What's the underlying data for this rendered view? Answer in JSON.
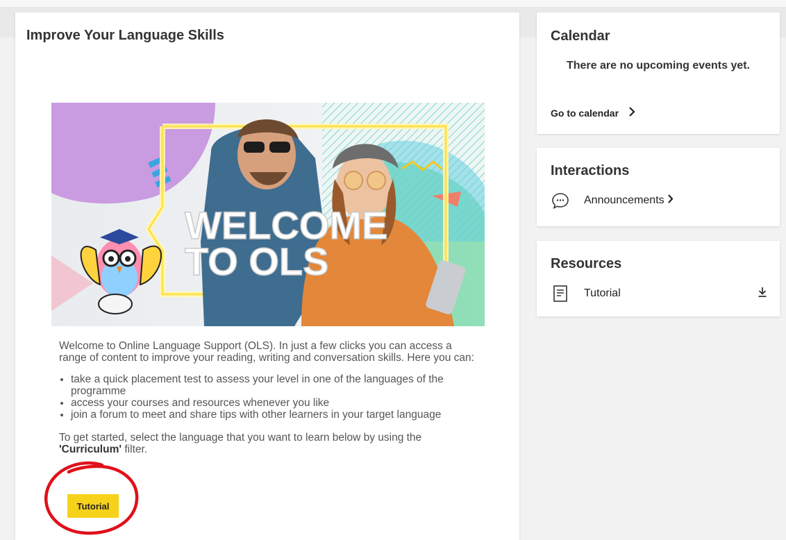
{
  "main": {
    "title": "Improve Your Language Skills",
    "banner": {
      "headline_line1": "WELCOME",
      "headline_line2": "TO OLS"
    },
    "intro": "Welcome to Online Language Support (OLS). In just a few clicks you can access a range of content to improve your reading, writing and conversation skills. Here you can:",
    "bullets": [
      "take a quick placement test to assess your level in one of the languages of the programme",
      "access your courses and resources whenever you like",
      "join a forum to meet and share tips with other learners in your target language"
    ],
    "getting_started_prefix": "To get started, select the language that you want to learn below by using the",
    "filter_name": "'Curriculum'",
    "getting_started_suffix": " filter.",
    "tutorial_button": "Tutorial"
  },
  "calendar": {
    "title": "Calendar",
    "empty_message": "There are no upcoming events yet.",
    "link": "Go to calendar"
  },
  "interactions": {
    "title": "Interactions",
    "items": [
      {
        "label": "Announcements",
        "icon": "speech-bubble-icon"
      }
    ]
  },
  "resources": {
    "title": "Resources",
    "items": [
      {
        "label": "Tutorial",
        "icon": "document-icon",
        "action_icon": "download-icon"
      }
    ]
  },
  "colors": {
    "accent_yellow": "#f7d21a",
    "annotation_red": "#e0101a",
    "page_background": "#f2f2f2"
  }
}
